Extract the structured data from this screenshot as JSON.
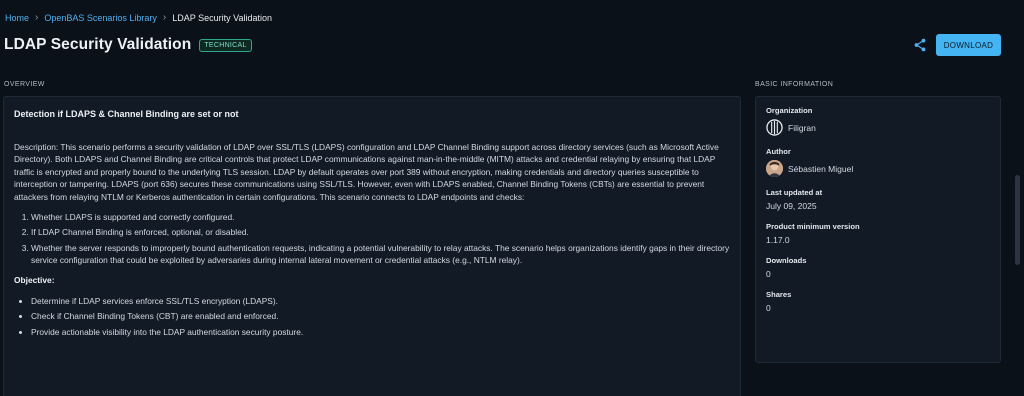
{
  "breadcrumb": {
    "home": "Home",
    "library": "OpenBAS Scenarios Library",
    "current": "LDAP Security Validation",
    "separator": "›"
  },
  "header": {
    "title": "LDAP Security Validation",
    "tag": "TECHNICAL",
    "share_icon": "share-icon",
    "download_label": "DOWNLOAD"
  },
  "overview": {
    "section_label": "OVERVIEW",
    "heading": "Detection if LDAPS & Channel Binding are set or not",
    "description": "Description: This scenario performs a security validation of LDAP over SSL/TLS (LDAPS) configuration and LDAP Channel Binding support across directory services (such as Microsoft Active Directory). Both LDAPS and Channel Binding are critical controls that protect LDAP communications against man-in-the-middle (MITM) attacks and credential relaying by ensuring that LDAP traffic is encrypted and properly bound to the underlying TLS session. LDAP by default operates over port 389 without encryption, making credentials and directory queries susceptible to interception or tampering. LDAPS (port 636) secures these communications using SSL/TLS. However, even with LDAPS enabled, Channel Binding Tokens (CBTs) are essential to prevent attackers from relaying NTLM or Kerberos authentication in certain configurations. This scenario connects to LDAP endpoints and checks:",
    "checks": [
      "Whether LDAPS is supported and correctly configured.",
      "If LDAP Channel Binding is enforced, optional, or disabled.",
      "Whether the server responds to improperly bound authentication requests, indicating a potential vulnerability to relay attacks. The scenario helps organizations identify gaps in their directory service configuration that could be exploited by adversaries during internal lateral movement or credential attacks (e.g., NTLM relay)."
    ],
    "objective_label": "Objective:",
    "objectives": [
      "Determine if LDAP services enforce SSL/TLS encryption (LDAPS).",
      "Check if Channel Binding Tokens (CBT) are enabled and enforced.",
      "Provide actionable visibility into the LDAP authentication security posture."
    ]
  },
  "basic_info": {
    "section_label": "BASIC INFORMATION",
    "organization_label": "Organization",
    "organization": "Filigran",
    "author_label": "Author",
    "author": "Sébastien Miguel",
    "updated_label": "Last updated at",
    "updated": "July 09, 2025",
    "version_label": "Product minimum version",
    "version": "1.17.0",
    "downloads_label": "Downloads",
    "downloads": "0",
    "shares_label": "Shares",
    "shares": "0"
  },
  "colors": {
    "accent": "#45b4f2",
    "background": "#0b1119",
    "panel": "#121a25",
    "tag_border": "#2ea88a"
  }
}
